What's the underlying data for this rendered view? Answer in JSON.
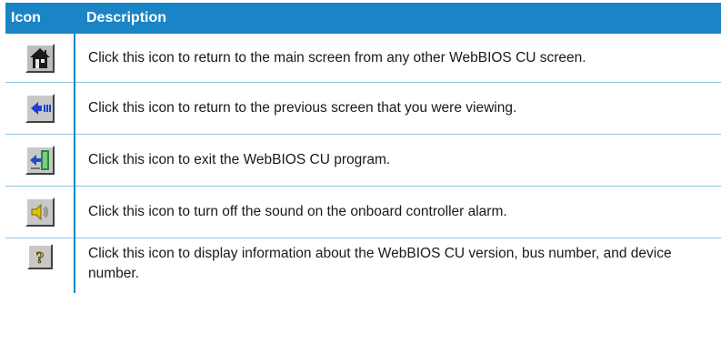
{
  "header": {
    "col_icon": "Icon",
    "col_description": "Description"
  },
  "rows": [
    {
      "icon": "home-icon",
      "description": "Click this icon to return to the main screen from any other WebBIOS CU screen."
    },
    {
      "icon": "back-arrow-icon",
      "description": "Click this icon to return to the previous screen that you were viewing."
    },
    {
      "icon": "exit-door-icon",
      "description": "Click this icon to exit the WebBIOS CU program."
    },
    {
      "icon": "speaker-mute-icon",
      "description": "Click this icon to turn off the sound on the onboard controller alarm."
    },
    {
      "icon": "question-mark-icon",
      "description": "Click this icon to display information about the WebBIOS CU version, bus number, and device number."
    }
  ],
  "colors": {
    "header_bg": "#1a85c6",
    "header_text": "#ffffff",
    "divider": "#8fc4e6"
  }
}
